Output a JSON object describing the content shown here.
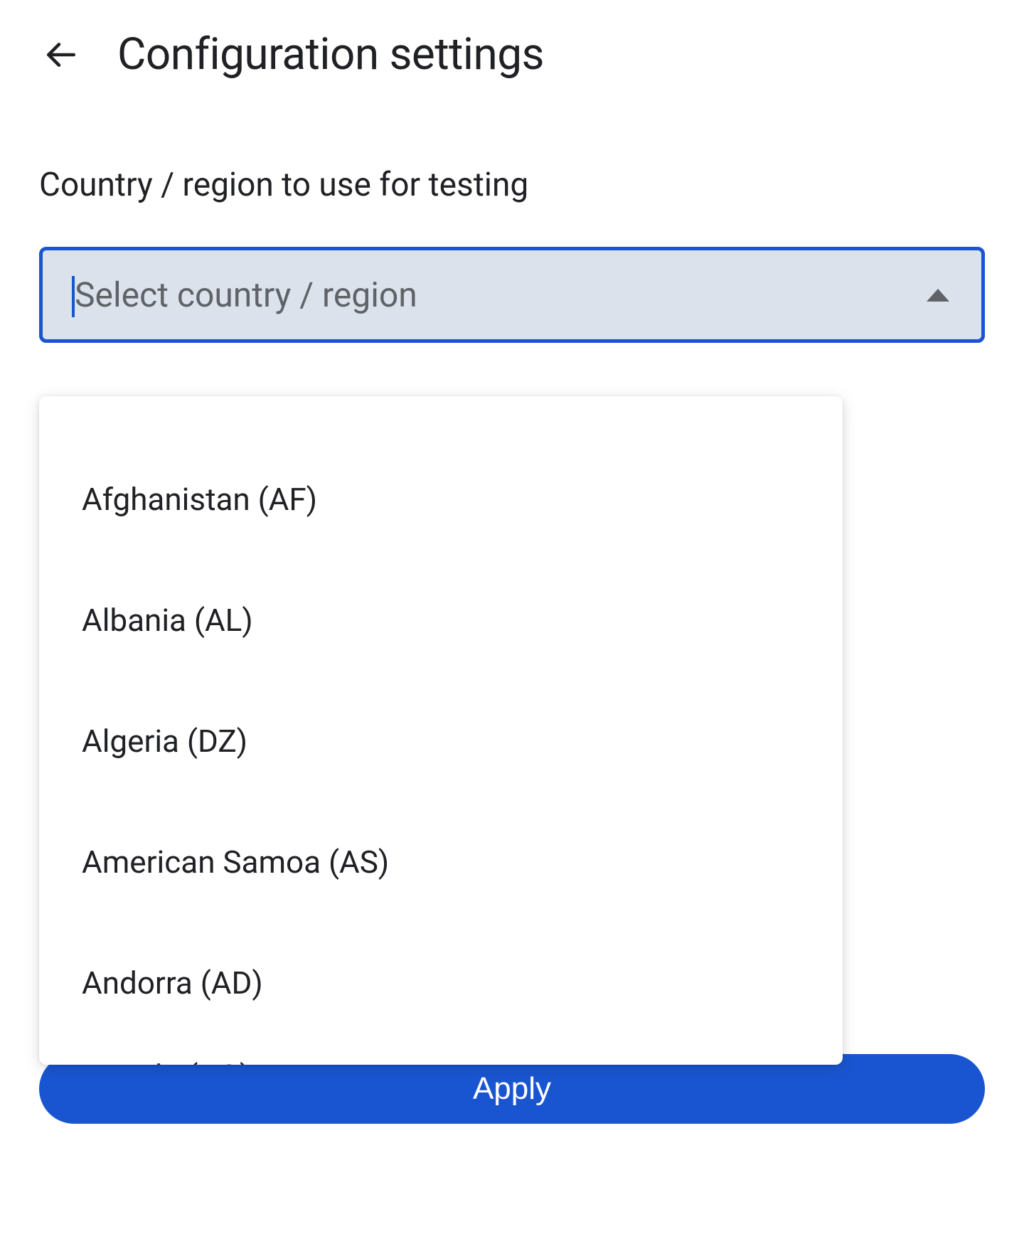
{
  "header": {
    "title": "Configuration settings"
  },
  "form": {
    "field_label": "Country / region to use for testing",
    "select_placeholder": "Select country / region",
    "apply_label": "Apply"
  },
  "dropdown": {
    "options": [
      "Afghanistan (AF)",
      "Albania (AL)",
      "Algeria (DZ)",
      "American Samoa (AS)",
      "Andorra (AD)"
    ],
    "partial_option": "Angola (AO)"
  }
}
